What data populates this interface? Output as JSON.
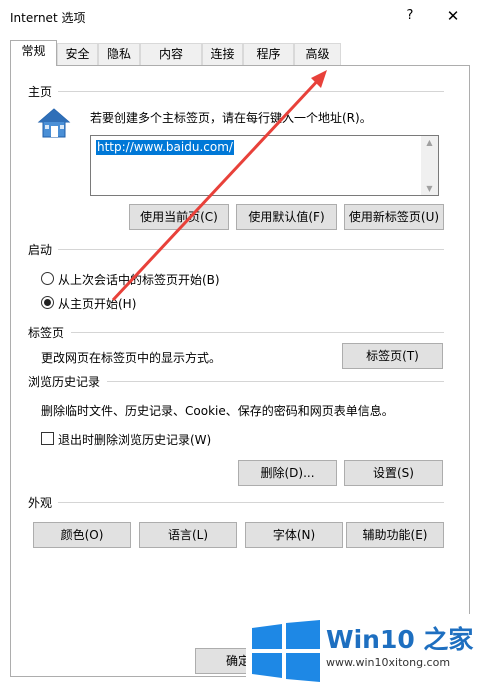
{
  "window": {
    "title": "Internet 选项",
    "help_label": "?",
    "close_label": "✕"
  },
  "tabs": [
    {
      "label": "常规",
      "active": true
    },
    {
      "label": "安全"
    },
    {
      "label": "隐私"
    },
    {
      "label": "内容"
    },
    {
      "label": "连接"
    },
    {
      "label": "程序"
    },
    {
      "label": "高级"
    }
  ],
  "home": {
    "group_label": "主页",
    "icon": "house-icon",
    "instruction": "若要创建多个主标签页，请在每行键入一个地址(R)。",
    "url": "http://www.baidu.com/",
    "btn_current": "使用当前页(C)",
    "btn_default": "使用默认值(F)",
    "btn_new_tab": "使用新标签页(U)"
  },
  "startup": {
    "group_label": "启动",
    "option_last": "从上次会话中的标签页开始(B)",
    "option_home": "从主页开始(H)",
    "selected": "home"
  },
  "tabs_group": {
    "group_label": "标签页",
    "description": "更改网页在标签页中的显示方式。",
    "btn_tabs": "标签页(T)"
  },
  "history": {
    "group_label": "浏览历史记录",
    "description": "删除临时文件、历史记录、Cookie、保存的密码和网页表单信息。",
    "checkbox_label": "退出时删除浏览历史记录(W)",
    "checkbox_checked": false,
    "btn_delete": "删除(D)...",
    "btn_settings": "设置(S)"
  },
  "appearance": {
    "group_label": "外观",
    "btn_colors": "颜色(O)",
    "btn_languages": "语言(L)",
    "btn_fonts": "字体(N)",
    "btn_accessibility": "辅助功能(E)"
  },
  "footer": {
    "ok_label": "确定"
  },
  "watermark": {
    "title": "Win10 之家",
    "url": "www.win10xitong.com"
  },
  "colors": {
    "accent": "#0078d7",
    "arrow": "#e8413a",
    "brand": "#1e6fc0"
  }
}
